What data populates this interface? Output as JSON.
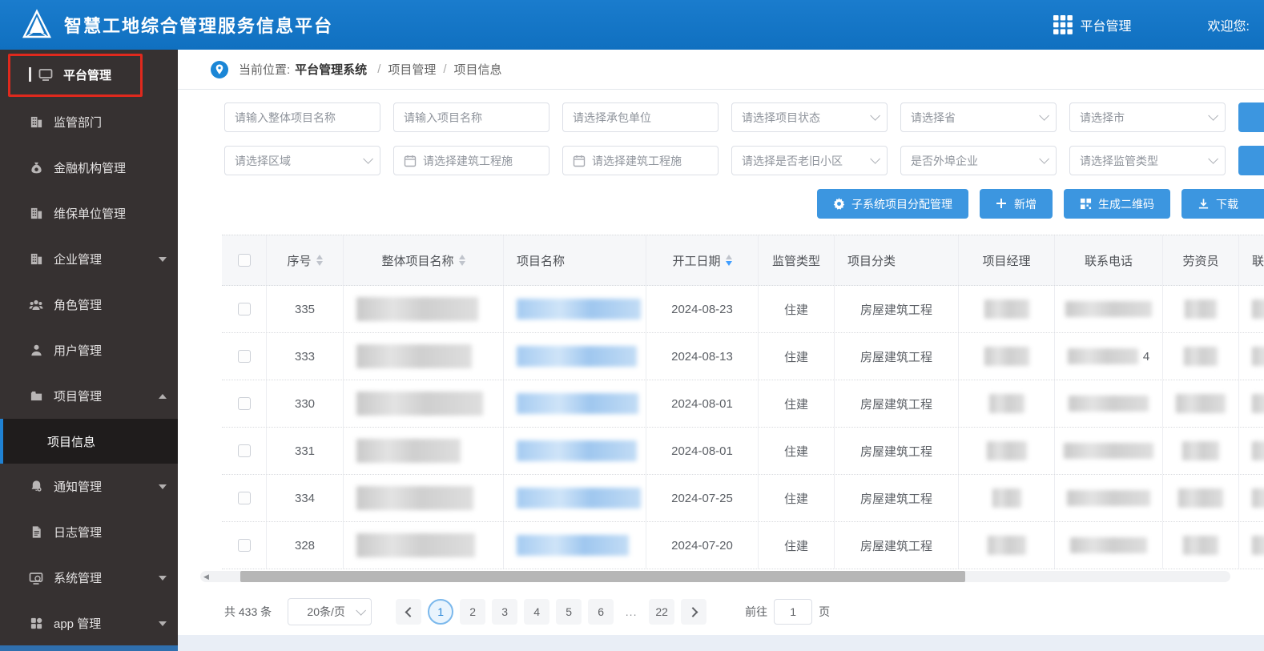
{
  "header": {
    "title": "智慧工地综合管理服务信息平台",
    "app_switcher_label": "平台管理",
    "welcome": "欢迎您:"
  },
  "sidebar": {
    "items": [
      {
        "label": "平台管理",
        "icon": "monitor-icon",
        "highlighted": true
      },
      {
        "label": "监管部门",
        "icon": "building-icon"
      },
      {
        "label": "金融机构管理",
        "icon": "moneybag-icon"
      },
      {
        "label": "维保单位管理",
        "icon": "building-icon"
      },
      {
        "label": "企业管理",
        "icon": "building-icon",
        "caret": "down"
      },
      {
        "label": "角色管理",
        "icon": "people-icon"
      },
      {
        "label": "用户管理",
        "icon": "user-icon"
      },
      {
        "label": "项目管理",
        "icon": "folder-icon",
        "caret": "up",
        "expanded": true,
        "children": [
          {
            "label": "项目信息",
            "active": true
          }
        ]
      },
      {
        "label": "通知管理",
        "icon": "bell-icon",
        "caret": "down"
      },
      {
        "label": "日志管理",
        "icon": "document-icon",
        "caret": "down_hidden"
      },
      {
        "label": "系统管理",
        "icon": "monitor-gear-icon",
        "caret": "down"
      },
      {
        "label": "app 管理",
        "icon": "app-grid-icon",
        "caret": "down"
      }
    ]
  },
  "breadcrumb": {
    "prefix": "当前位置:",
    "root": "平台管理系统",
    "separator": "/",
    "level1": "项目管理",
    "level2": "项目信息"
  },
  "filters": {
    "row1": [
      {
        "type": "text",
        "placeholder": "请输入整体项目名称"
      },
      {
        "type": "text",
        "placeholder": "请输入项目名称"
      },
      {
        "type": "text",
        "placeholder": "请选择承包单位"
      },
      {
        "type": "select",
        "placeholder": "请选择项目状态"
      },
      {
        "type": "select",
        "placeholder": "请选择省"
      },
      {
        "type": "select",
        "placeholder": "请选择市"
      }
    ],
    "row2": [
      {
        "type": "select",
        "placeholder": "请选择区域"
      },
      {
        "type": "date",
        "placeholder": "请选择建筑工程施"
      },
      {
        "type": "date",
        "placeholder": "请选择建筑工程施"
      },
      {
        "type": "select",
        "placeholder": "请选择是否老旧小区"
      },
      {
        "type": "select",
        "placeholder": "是否外埠企业"
      },
      {
        "type": "select",
        "placeholder": "请选择监管类型"
      }
    ]
  },
  "toolbar": {
    "buttons": [
      {
        "label": "子系统项目分配管理",
        "icon": "gear-icon"
      },
      {
        "label": "新增",
        "icon": "plus-icon"
      },
      {
        "label": "生成二维码",
        "icon": "qrcode-icon"
      },
      {
        "label": "下载",
        "icon": "download-icon"
      }
    ]
  },
  "table": {
    "columns": [
      "序号",
      "整体项目名称",
      "项目名称",
      "开工日期",
      "监管类型",
      "项目分类",
      "项目经理",
      "联系电话",
      "劳资员",
      "联系电话"
    ],
    "sorted_column": "开工日期",
    "sort_direction": "desc",
    "rows": [
      {
        "seq": "335",
        "date": "2024-08-23",
        "supervision": "住建",
        "category": "房屋建筑工程",
        "phone_visible": ""
      },
      {
        "seq": "333",
        "date": "2024-08-13",
        "supervision": "住建",
        "category": "房屋建筑工程",
        "phone_visible": "4"
      },
      {
        "seq": "330",
        "date": "2024-08-01",
        "supervision": "住建",
        "category": "房屋建筑工程",
        "phone_visible": ""
      },
      {
        "seq": "331",
        "date": "2024-08-01",
        "supervision": "住建",
        "category": "房屋建筑工程",
        "phone_visible": ""
      },
      {
        "seq": "334",
        "date": "2024-07-25",
        "supervision": "住建",
        "category": "房屋建筑工程",
        "phone_visible": ""
      },
      {
        "seq": "328",
        "date": "2024-07-20",
        "supervision": "住建",
        "category": "房屋建筑工程",
        "phone_visible": ""
      }
    ]
  },
  "pagination": {
    "total_text": "共 433 条",
    "page_size": "20条/页",
    "pages": [
      "1",
      "2",
      "3",
      "4",
      "5",
      "6",
      "...",
      "22"
    ],
    "active_page": "1",
    "jump_prefix": "前往",
    "jump_value": "1",
    "jump_suffix": "页"
  },
  "colors": {
    "header_blue": "#1274c6",
    "sidebar_dark": "#363131",
    "highlight_red": "#df291d",
    "button_blue": "#3c96e0",
    "active_sort_blue": "#409eff",
    "active_page_blue": "#2b88d9",
    "link_blur_blue": "#a5cbf1"
  }
}
